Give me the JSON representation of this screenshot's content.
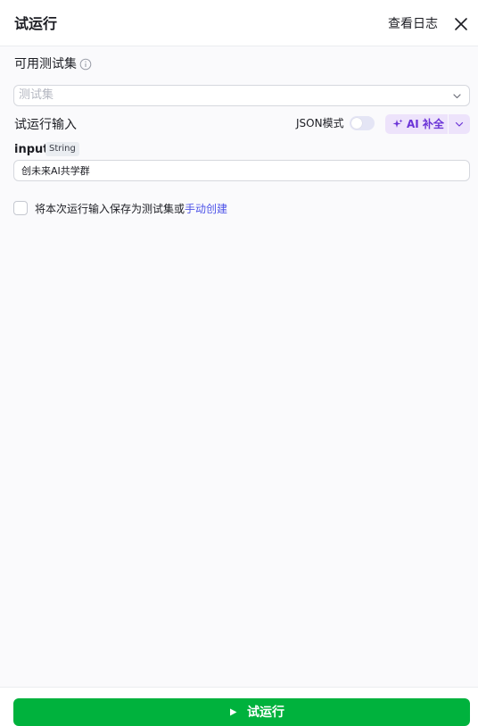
{
  "header": {
    "title": "试运行",
    "view_logs_label": "查看日志",
    "close_icon": "close-icon"
  },
  "test_set": {
    "label": "可用测试集",
    "info_icon": "info-icon",
    "placeholder": "测试集",
    "chevron_icon": "chevron-down-icon"
  },
  "run_input": {
    "label": "试运行输入",
    "json_mode_label": "JSON模式",
    "json_mode_on": false,
    "ai_complete_label": "AI 补全",
    "ai_icon": "sparkle-icon",
    "ai_dropdown_icon": "chevron-down-icon",
    "params": [
      {
        "name": "input",
        "type": "String",
        "value": "创未来AI共学群"
      }
    ]
  },
  "save_option": {
    "checked": false,
    "text": "将本次运行输入保存为测试集或",
    "link_text": "手动创建"
  },
  "footer": {
    "run_label": "试运行",
    "run_icon": "play-icon"
  },
  "colors": {
    "primary_green": "#00b23d",
    "link_blue": "#4d53e8",
    "ai_purple": "#6b34d7",
    "ai_bg": "#ede3fb"
  }
}
